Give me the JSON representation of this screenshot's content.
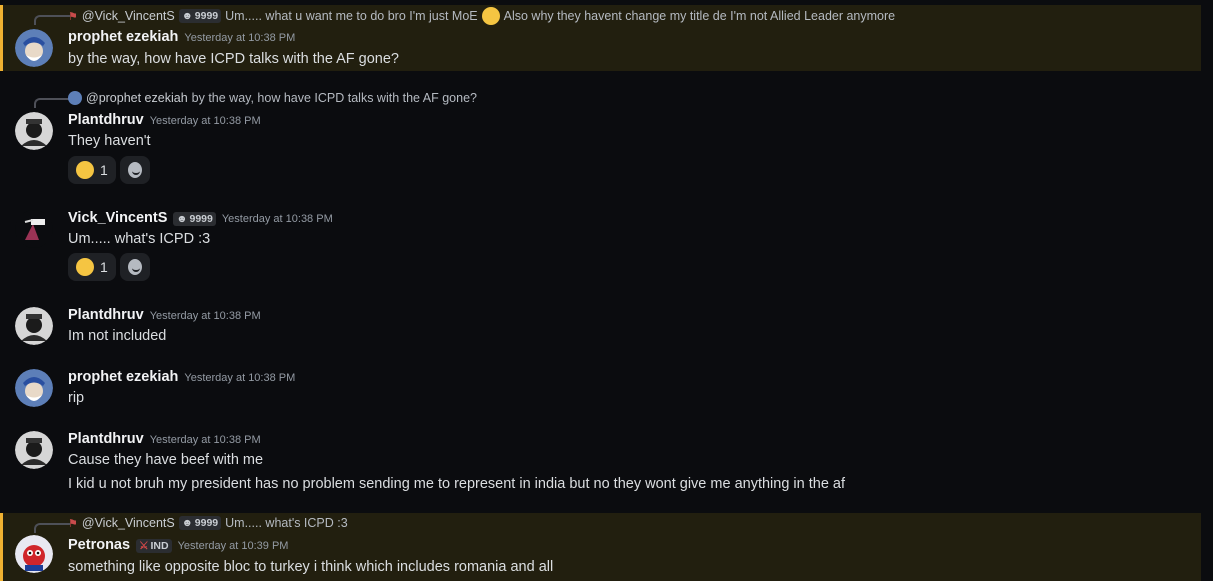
{
  "messages": [
    {
      "reply": {
        "user": "@Vick_VincentS",
        "badge": "9999",
        "text": "Um..... what u want me to do bro I'm just MoE",
        "text2": "Also why they havent change my title de I'm not Allied Leader anymore"
      },
      "user": "prophet ezekiah",
      "time": "Yesterday at 10:38 PM",
      "text": "by the way, how have ICPD talks with the AF gone?"
    },
    {
      "reply": {
        "user": "@prophet ezekiah",
        "text": "by the way, how have ICPD talks with the AF gone?"
      },
      "user": "Plantdhruv",
      "time": "Yesterday at 10:38 PM",
      "text": "They haven't",
      "reaction_count": "1"
    },
    {
      "user": "Vick_VincentS",
      "badge": "9999",
      "time": "Yesterday at 10:38 PM",
      "text": "Um..... what's ICPD :3",
      "reaction_count": "1"
    },
    {
      "user": "Plantdhruv",
      "time": "Yesterday at 10:38 PM",
      "text": "Im not included"
    },
    {
      "user": "prophet ezekiah",
      "time": "Yesterday at 10:38 PM",
      "text": "rip"
    },
    {
      "user": "Plantdhruv",
      "time": "Yesterday at 10:38 PM",
      "text": "Cause they have beef with me",
      "text2": "I kid u not bruh my president has no problem sending me to represent in india but no they wont give me anything in the af"
    },
    {
      "reply": {
        "user": "@Vick_VincentS",
        "badge": "9999",
        "text": "Um..... what's ICPD :3"
      },
      "user": "Petronas",
      "tag": "IND",
      "time": "Yesterday at 10:39 PM",
      "text": "something like opposite bloc to turkey i think which includes romania and all"
    }
  ],
  "colors": {
    "highlight_bg": "#221f0f",
    "highlight_border": "#f0b232"
  }
}
